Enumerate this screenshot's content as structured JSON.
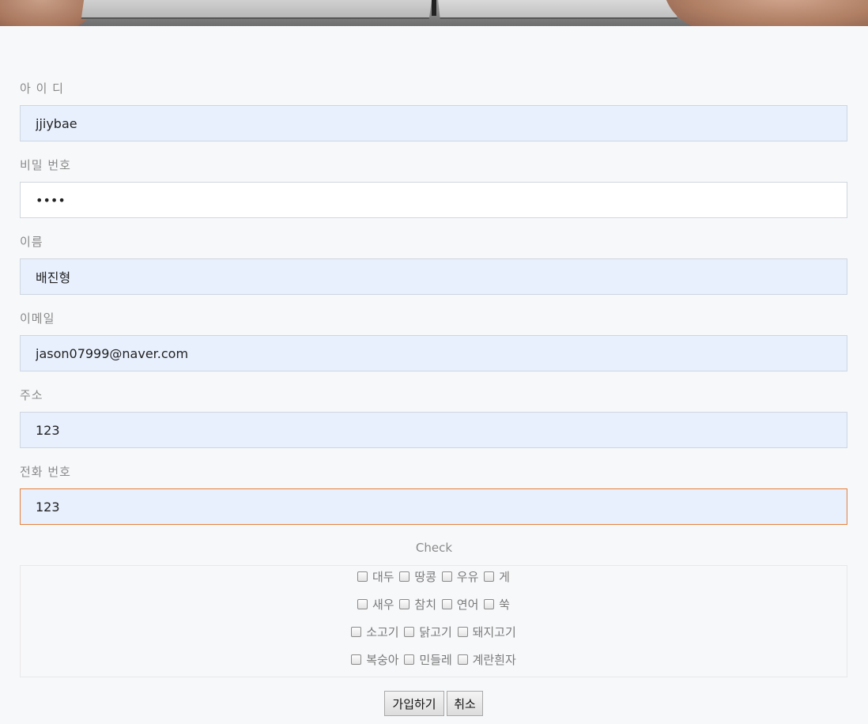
{
  "form": {
    "id": {
      "label": "아 이 디",
      "value": "jjiybae"
    },
    "password": {
      "label": "비밀 번호",
      "value": "••••"
    },
    "name": {
      "label": "이름",
      "value": "배진형"
    },
    "email": {
      "label": "이메일",
      "value": "jason07999@naver.com"
    },
    "address": {
      "label": "주소",
      "value": "123"
    },
    "phone": {
      "label": "전화 번호",
      "value": "123"
    }
  },
  "check": {
    "title": "Check",
    "rows": [
      [
        "대두",
        "땅콩",
        "우유",
        "게"
      ],
      [
        "새우",
        "참치",
        "연어",
        "쑥"
      ],
      [
        "소고기",
        "닭고기",
        "돼지고기"
      ],
      [
        "복숭아",
        "민들레",
        "계란흰자"
      ]
    ]
  },
  "buttons": {
    "submit": "가입하기",
    "cancel": "취소"
  }
}
